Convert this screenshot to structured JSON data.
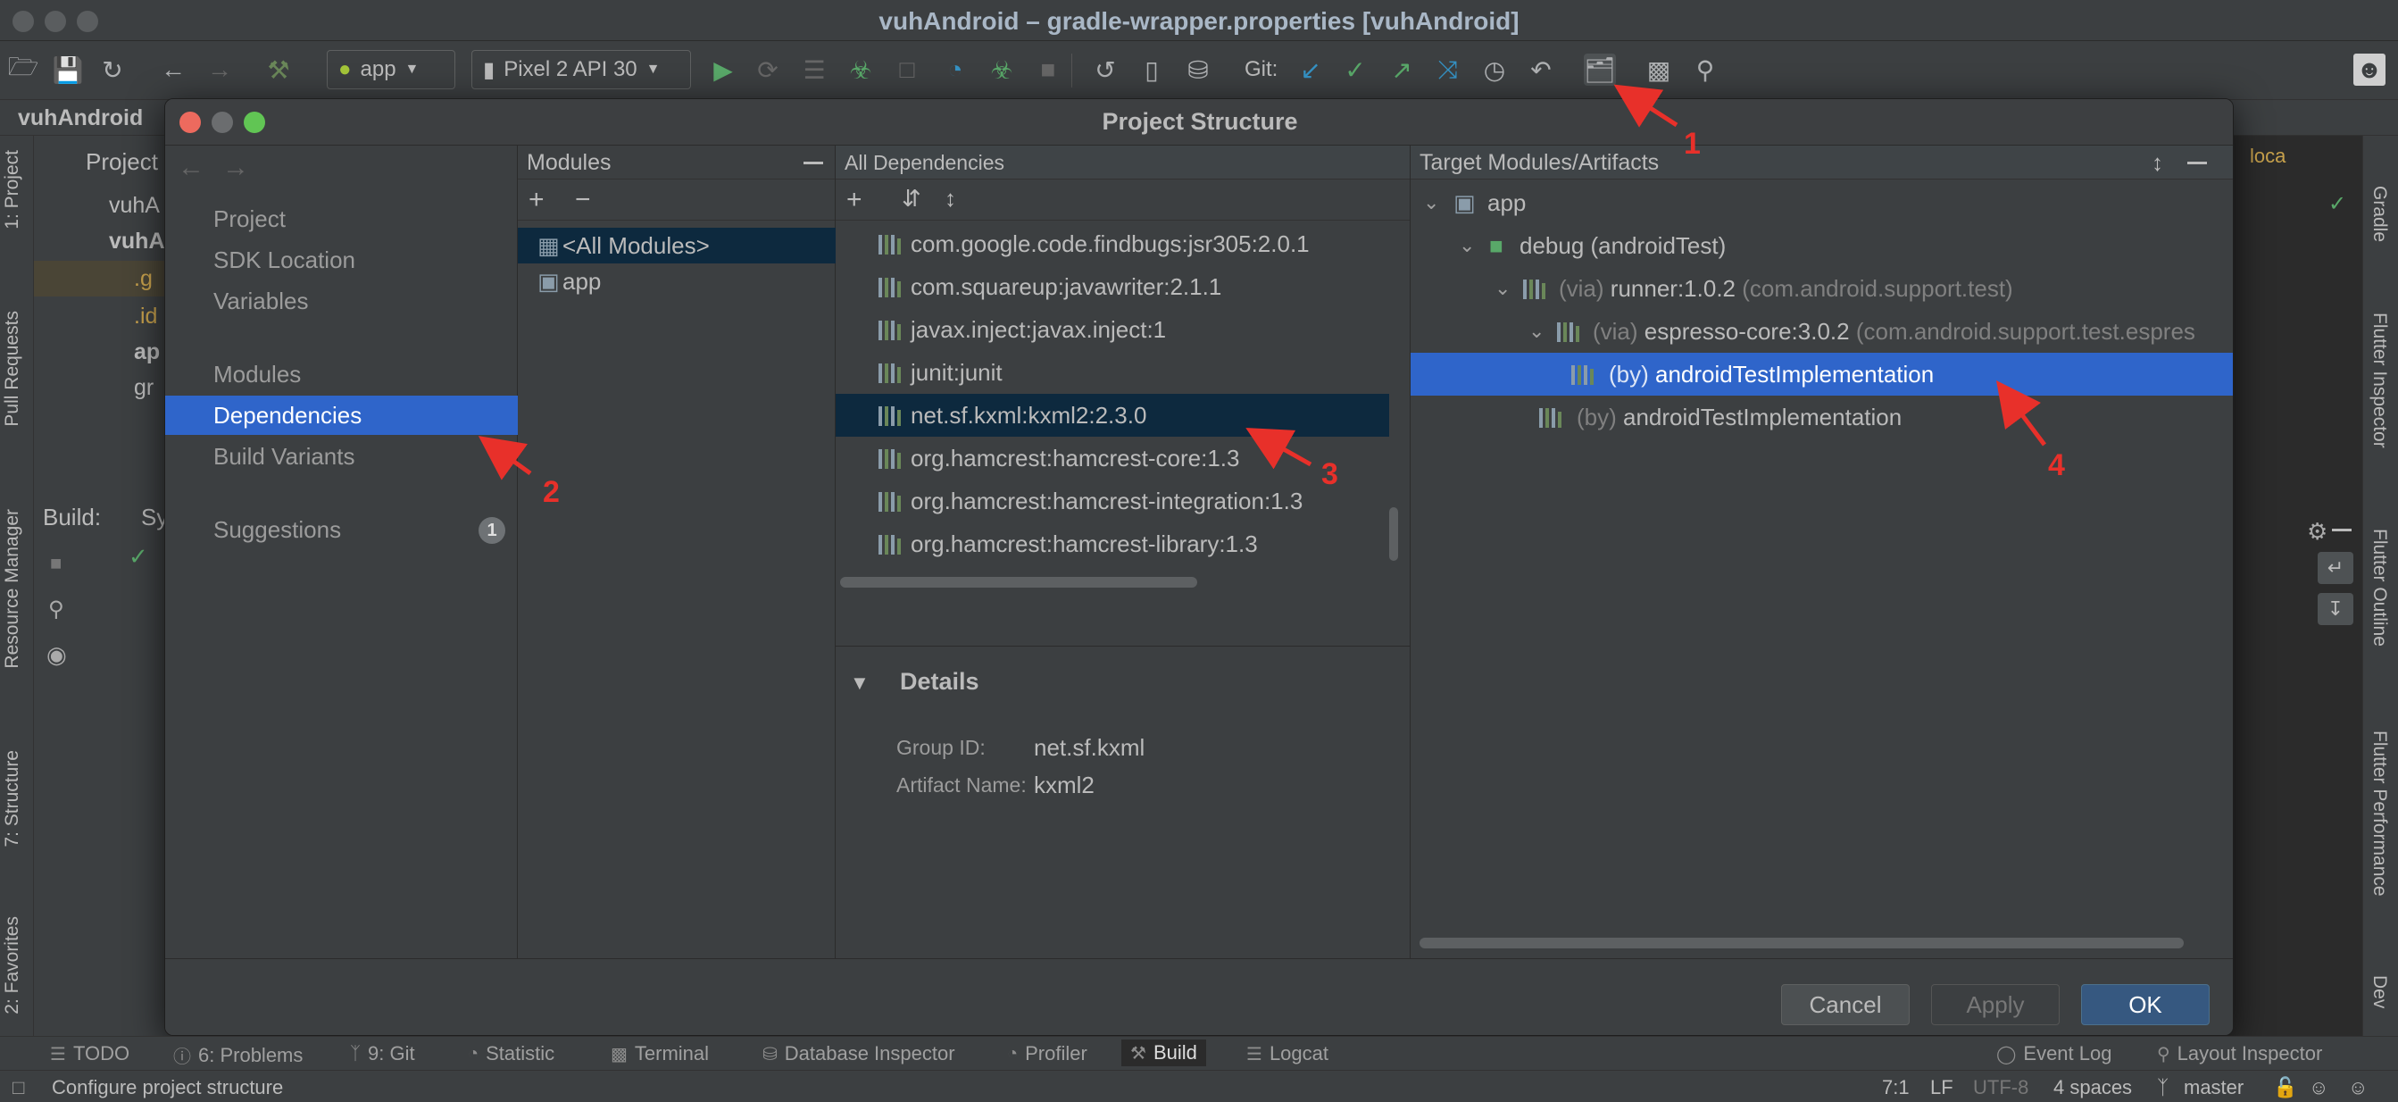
{
  "window": {
    "title": "vuhAndroid – gradle-wrapper.properties [vuhAndroid]"
  },
  "toolbar": {
    "run_config": "app",
    "device": "Pixel 2 API 30",
    "git_label": "Git:"
  },
  "breadcrumb": {
    "root": "vuhAndroid"
  },
  "left_stripe": [
    "1: Project",
    "Pull Requests",
    "Resource Manager",
    "7: Structure",
    "2: Favorites"
  ],
  "right_stripe": [
    "Gradle",
    "Flutter Inspector",
    "Flutter Outline",
    "Flutter Performance",
    "Dev"
  ],
  "background": {
    "project_title": "Project",
    "project_rows": [
      "vuhA",
      "vuhA",
      ".g",
      ".id",
      "ap",
      "gr"
    ],
    "build_title": "Build:",
    "build_tab": "Sy",
    "right_label": "loca"
  },
  "dialog": {
    "title": "Project Structure",
    "nav": {
      "items": [
        {
          "label": "Project"
        },
        {
          "label": "SDK Location"
        },
        {
          "label": "Variables"
        },
        {
          "label": "Modules"
        },
        {
          "label": "Dependencies",
          "selected": true
        },
        {
          "label": "Build Variants"
        },
        {
          "label": "Suggestions",
          "badge": "1"
        }
      ]
    },
    "modules": {
      "header": "Modules",
      "items": [
        {
          "label": "<All Modules>",
          "selected": true
        },
        {
          "label": "app"
        }
      ]
    },
    "dependencies": {
      "header": "All Dependencies",
      "items": [
        {
          "label": "com.google.code.findbugs:jsr305:2.0.1"
        },
        {
          "label": "com.squareup:javawriter:2.1.1"
        },
        {
          "label": "javax.inject:javax.inject:1"
        },
        {
          "label": "junit:junit"
        },
        {
          "label": "net.sf.kxml:kxml2:2.3.0",
          "selected": true
        },
        {
          "label": "org.hamcrest:hamcrest-core:1.3"
        },
        {
          "label": "org.hamcrest:hamcrest-integration:1.3"
        },
        {
          "label": "org.hamcrest:hamcrest-library:1.3"
        }
      ],
      "details": {
        "title": "Details",
        "group_label": "Group ID:",
        "group_value": "net.sf.kxml",
        "artifact_label": "Artifact Name:",
        "artifact_value": "kxml2"
      }
    },
    "targets": {
      "header": "Target Modules/Artifacts",
      "rows": [
        {
          "prefix": "",
          "main": "app",
          "suffix": ""
        },
        {
          "prefix": "",
          "main": "debug (androidTest)",
          "suffix": ""
        },
        {
          "prefix": "(via)",
          "main": "runner:1.0.2",
          "suffix": "(com.android.support.test)"
        },
        {
          "prefix": "(via)",
          "main": "espresso-core:3.0.2",
          "suffix": "(com.android.support.test.espres"
        },
        {
          "prefix": "(by)",
          "main": "androidTestImplementation",
          "suffix": "",
          "selected": true
        },
        {
          "prefix": "(by)",
          "main": "androidTestImplementation",
          "suffix": ""
        }
      ]
    },
    "buttons": {
      "cancel": "Cancel",
      "apply": "Apply",
      "ok": "OK"
    }
  },
  "annotations": [
    "1",
    "2",
    "3",
    "4"
  ],
  "bottom_tabs": [
    "TODO",
    "6: Problems",
    "9: Git",
    "Statistic",
    "Terminal",
    "Database Inspector",
    "Profiler",
    "Build",
    "Logcat",
    "Event Log",
    "Layout Inspector"
  ],
  "status": {
    "message": "Configure project structure",
    "position": "7:1",
    "line_sep": "LF",
    "encoding": "UTF-8",
    "indent": "4 spaces",
    "branch": "master"
  },
  "colors": {
    "selection": "#2f65ca",
    "annotation": "#e8302a",
    "background": "#3c3f41"
  }
}
